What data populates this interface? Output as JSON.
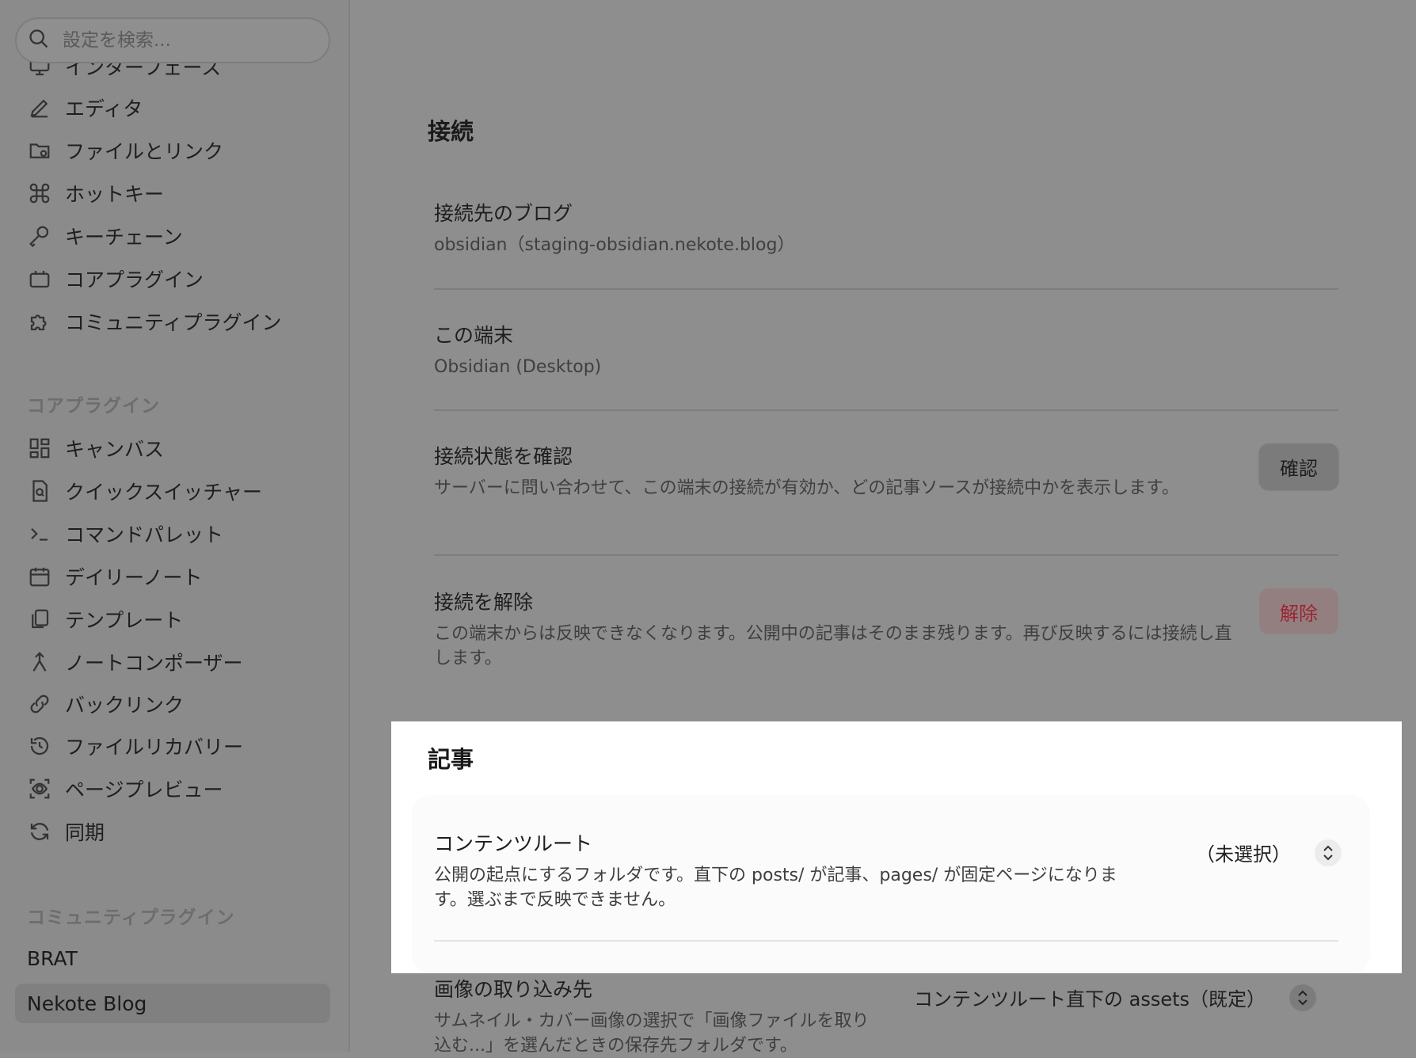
{
  "search": {
    "placeholder": "設定を検索..."
  },
  "sidebar": {
    "partial_item": "インターフェース",
    "options_items": [
      {
        "label": "エディタ",
        "icon": "pencil-icon"
      },
      {
        "label": "ファイルとリンク",
        "icon": "folder-gear-icon"
      },
      {
        "label": "ホットキー",
        "icon": "command-icon"
      },
      {
        "label": "キーチェーン",
        "icon": "key-icon"
      },
      {
        "label": "コアプラグイン",
        "icon": "calendar-box-icon"
      },
      {
        "label": "コミュニティプラグイン",
        "icon": "puzzle-icon"
      }
    ],
    "core_plugins_heading": "コアプラグイン",
    "core_plugins": [
      {
        "label": "キャンバス",
        "icon": "layout-dashboard-icon"
      },
      {
        "label": "クイックスイッチャー",
        "icon": "file-search-icon"
      },
      {
        "label": "コマンドパレット",
        "icon": "terminal-icon"
      },
      {
        "label": "デイリーノート",
        "icon": "calendar-icon"
      },
      {
        "label": "テンプレート",
        "icon": "files-icon"
      },
      {
        "label": "ノートコンポーザー",
        "icon": "merge-icon"
      },
      {
        "label": "バックリンク",
        "icon": "backlink-icon"
      },
      {
        "label": "ファイルリカバリー",
        "icon": "history-icon"
      },
      {
        "label": "ページプレビュー",
        "icon": "scan-eye-icon"
      },
      {
        "label": "同期",
        "icon": "refresh-icon"
      }
    ],
    "community_plugins_heading": "コミュニティプラグイン",
    "community_plugins": [
      "BRAT",
      "Nekote Blog"
    ]
  },
  "connection": {
    "heading": "接続",
    "blog": {
      "title": "接続先のブログ",
      "value": "obsidian（staging-obsidian.nekote.blog）"
    },
    "device": {
      "title": "この端末",
      "value": "Obsidian (Desktop)"
    },
    "check": {
      "title": "接続状態を確認",
      "desc": "サーバーに問い合わせて、この端末の接続が有効か、どの記事ソースが接続中かを表示します。",
      "button": "確認"
    },
    "disconnect": {
      "title": "接続を解除",
      "desc": "この端末からは反映できなくなります。公開中の記事はそのまま残ります。再び反映するには接続し直します。",
      "button": "解除"
    }
  },
  "articles": {
    "heading": "記事",
    "content_root": {
      "title": "コンテンツルート",
      "desc": "公開の起点にするフォルダです。直下の posts/ が記事、pages/ が固定ページになります。選ぶまで反映できません。",
      "value": "（未選択）"
    },
    "image_dest": {
      "title": "画像の取り込み先",
      "desc": "サムネイル・カバー画像の選択で「画像ファイルを取り込む...」を選んだときの保存先フォルダです。",
      "value": "コンテンツルート直下の assets（既定）"
    }
  },
  "colors": {
    "overlay_bg": "#8e8e8e",
    "highlight_bg": "#ffffff",
    "danger_text": "#9a2434"
  }
}
